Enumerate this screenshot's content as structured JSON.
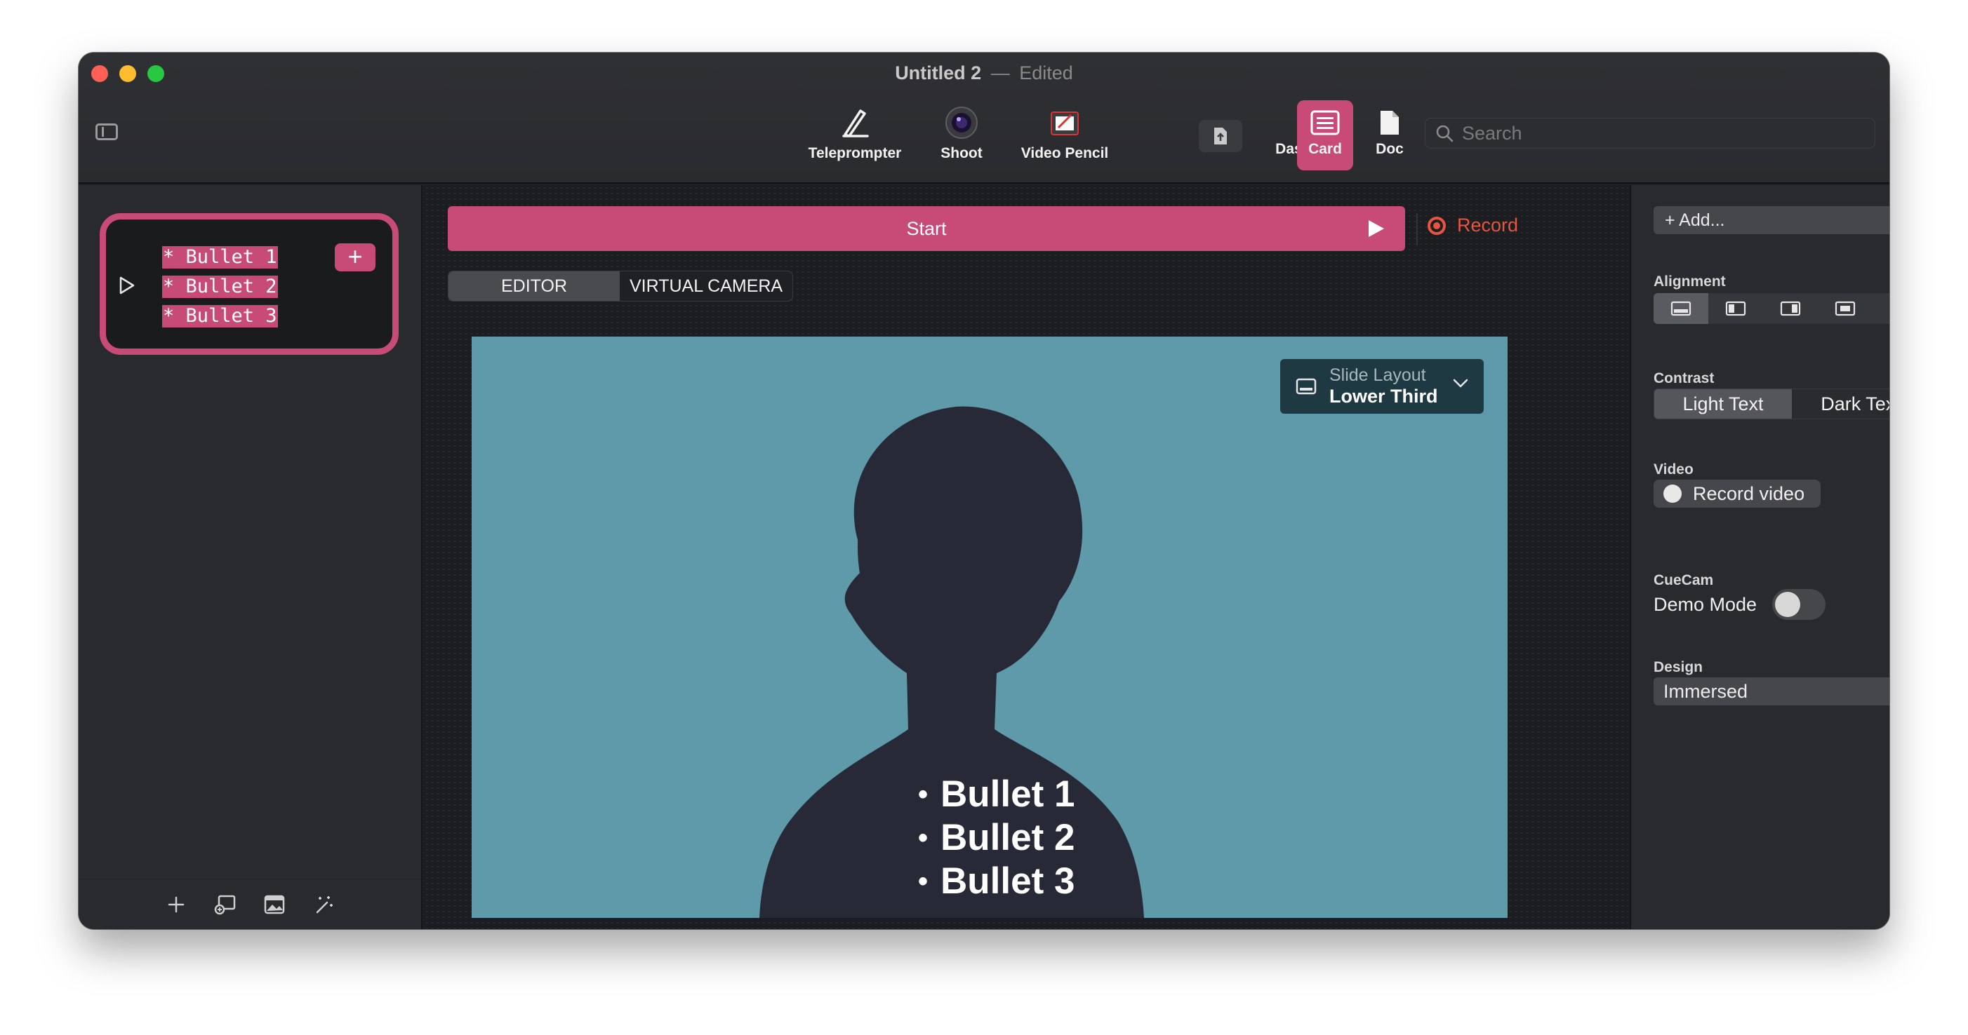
{
  "window": {
    "title": "Untitled 2",
    "separator": "—",
    "status": "Edited"
  },
  "toolbar": {
    "tools": [
      {
        "label": "Teleprompter",
        "icon": "pen-icon"
      },
      {
        "label": "Shoot",
        "icon": "camera-lens-icon"
      },
      {
        "label": "Video Pencil",
        "icon": "video-pencil-icon"
      },
      {
        "label": "",
        "icon": "export-document-icon"
      },
      {
        "label": "Dashboard",
        "icon": "list-icon"
      },
      {
        "label": "Card",
        "icon": "card-icon",
        "active": true
      },
      {
        "label": "Doc",
        "icon": "document-icon"
      }
    ],
    "search_placeholder": "Search"
  },
  "sidebar": {
    "card": {
      "lines": [
        "* Bullet 1",
        "* Bullet 2",
        "* Bullet 3"
      ],
      "add_label": "+"
    },
    "bottom_icons": [
      "plus-icon",
      "add-card-icon",
      "image-icon",
      "magic-wand-icon"
    ]
  },
  "main": {
    "start_label": "Start",
    "record_label": "Record",
    "tabs": [
      {
        "label": "EDITOR",
        "selected": true
      },
      {
        "label": "VIRTUAL CAMERA",
        "selected": false
      }
    ],
    "preview": {
      "slide_layout_caption": "Slide Layout",
      "slide_layout_value": "Lower Third",
      "bullets": [
        "Bullet 1",
        "Bullet 2",
        "Bullet 3"
      ],
      "bullet_glyph": "•",
      "background_color": "#5e9aa9"
    }
  },
  "inspector": {
    "add_label": "+ Add...",
    "alignment_label": "Alignment",
    "alignment_options": [
      "align-bottom-icon",
      "align-left-icon",
      "align-right-icon",
      "align-center-icon",
      "align-top-icon"
    ],
    "contrast_label": "Contrast",
    "contrast_options": [
      {
        "label": "Light Text",
        "selected": true
      },
      {
        "label": "Dark Text",
        "selected": false
      }
    ],
    "video_label": "Video",
    "record_video_label": "Record video",
    "cuecam_label": "CueCam",
    "demo_mode_label": "Demo Mode",
    "demo_mode_on": false,
    "design_label": "Design",
    "design_value": "Immersed"
  },
  "colors": {
    "accent": "#c84a77",
    "record": "#e8543f",
    "window_bg": "#1f2023"
  }
}
